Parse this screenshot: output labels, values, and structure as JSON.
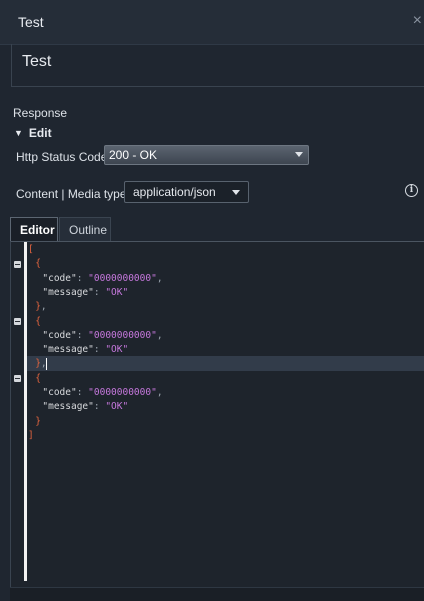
{
  "window": {
    "title": "Test",
    "close_symbol": "×"
  },
  "header": {
    "title": "Test"
  },
  "response": {
    "label": "Response",
    "edit_label": "Edit",
    "http_status": {
      "label": "Http Status Code:",
      "value": "200 - OK"
    },
    "media_type": {
      "label": "Content | Media type:",
      "value": "application/json"
    }
  },
  "tabs": {
    "editor": "Editor",
    "outline": "Outline"
  },
  "editor": {
    "lines": [
      {
        "indent": 0,
        "tokens": [
          [
            "punc",
            "["
          ]
        ]
      },
      {
        "indent": 2,
        "tokens": [
          [
            "punc",
            "{"
          ]
        ]
      },
      {
        "indent": 4,
        "tokens": [
          [
            "key",
            "\"code\""
          ],
          [
            "col",
            ": "
          ],
          [
            "str",
            "\"0000000000\""
          ],
          [
            "col",
            ","
          ]
        ]
      },
      {
        "indent": 4,
        "tokens": [
          [
            "key",
            "\"message\""
          ],
          [
            "col",
            ": "
          ],
          [
            "str",
            "\"OK\""
          ]
        ]
      },
      {
        "indent": 2,
        "tokens": [
          [
            "punc",
            "}"
          ],
          [
            "col",
            ","
          ]
        ]
      },
      {
        "indent": 2,
        "tokens": [
          [
            "punc",
            "{"
          ]
        ]
      },
      {
        "indent": 4,
        "tokens": [
          [
            "key",
            "\"code\""
          ],
          [
            "col",
            ": "
          ],
          [
            "str",
            "\"0000000000\""
          ],
          [
            "col",
            ","
          ]
        ]
      },
      {
        "indent": 4,
        "tokens": [
          [
            "key",
            "\"message\""
          ],
          [
            "col",
            ": "
          ],
          [
            "str",
            "\"OK\""
          ]
        ]
      },
      {
        "indent": 2,
        "tokens": [
          [
            "punc",
            "}"
          ],
          [
            "col",
            ","
          ]
        ]
      },
      {
        "indent": 2,
        "tokens": [
          [
            "punc",
            "{"
          ]
        ]
      },
      {
        "indent": 4,
        "tokens": [
          [
            "key",
            "\"code\""
          ],
          [
            "col",
            ": "
          ],
          [
            "str",
            "\"0000000000\""
          ],
          [
            "col",
            ","
          ]
        ]
      },
      {
        "indent": 4,
        "tokens": [
          [
            "key",
            "\"message\""
          ],
          [
            "col",
            ": "
          ],
          [
            "str",
            "\"OK\""
          ]
        ]
      },
      {
        "indent": 2,
        "tokens": [
          [
            "punc",
            "}"
          ]
        ]
      },
      {
        "indent": 0,
        "tokens": [
          [
            "punc",
            "]"
          ]
        ]
      }
    ]
  },
  "colors": {
    "bracket": "#e2643e",
    "string": "#c678dd",
    "key": "#d7d9dc"
  }
}
